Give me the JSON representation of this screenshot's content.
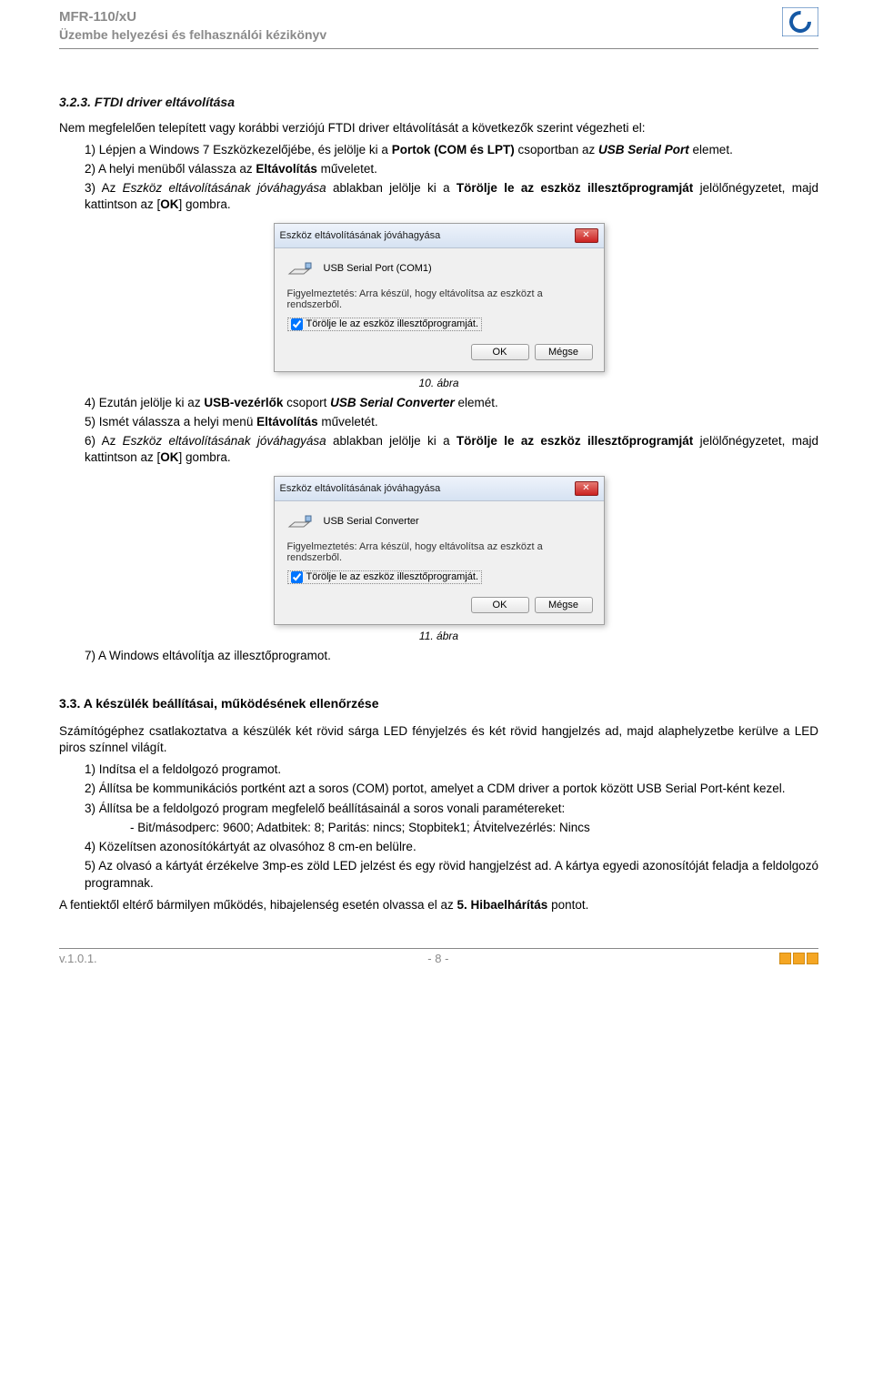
{
  "header": {
    "product": "MFR-110/xU",
    "subtitle": "Üzembe helyezési és felhasználói kézikönyv"
  },
  "s323": {
    "heading_num": "3.2.3.",
    "heading_text": "FTDI driver eltávolítása",
    "intro": "Nem megfelelően telepített vagy korábbi verziójú FTDI driver eltávolítását a következők szerint végezheti el:",
    "li1_a": "1) Lépjen a Windows 7 Eszközkezelőjébe, és jelölje ki a ",
    "li1_b": "Portok (COM és LPT)",
    "li1_c": " csoportban az ",
    "li1_d": "USB Serial Port",
    "li1_e": " elemet.",
    "li2_a": "2) A helyi menüből válassza az ",
    "li2_b": "Eltávolítás",
    "li2_c": " műveletet.",
    "li3_a": "3) Az ",
    "li3_b": "Eszköz eltávolításának jóváhagyása",
    "li3_c": " ablakban jelölje ki a ",
    "li3_d": "Törölje le az eszköz illesztőprogramját",
    "li3_e": " jelölőnégyzetet, majd kattintson az [",
    "li3_f": "OK",
    "li3_g": "] gombra.",
    "fig10": "10. ábra",
    "li4_a": "4) Ezután jelölje ki az ",
    "li4_b": "USB-vezérlők",
    "li4_c": " csoport ",
    "li4_d": "USB Serial Converter",
    "li4_e": " elemét.",
    "li5_a": "5) Ismét válassza a helyi menü ",
    "li5_b": "Eltávolítás",
    "li5_c": " műveletét.",
    "li6_a": "6) Az ",
    "li6_b": "Eszköz eltávolításának jóváhagyása",
    "li6_c": " ablakban jelölje ki a ",
    "li6_d": "Törölje le az eszköz illesztőprogramját",
    "li6_e": " jelölőnégyzetet, majd kattintson az [",
    "li6_f": "OK",
    "li6_g": "] gombra.",
    "fig11": "11. ábra",
    "li7": "7) A Windows eltávolítja az illesztőprogramot."
  },
  "dialog1": {
    "title": "Eszköz eltávolításának jóváhagyása",
    "device": "USB Serial Port (COM1)",
    "warn": "Figyelmeztetés: Arra készül, hogy eltávolítsa az eszközt a rendszerből.",
    "chk": "Törölje le az eszköz illesztőprogramját.",
    "ok": "OK",
    "cancel": "Mégse"
  },
  "dialog2": {
    "title": "Eszköz eltávolításának jóváhagyása",
    "device": "USB Serial Converter",
    "warn": "Figyelmeztetés: Arra készül, hogy eltávolítsa az eszközt a rendszerből.",
    "chk": "Törölje le az eszköz illesztőprogramját.",
    "ok": "OK",
    "cancel": "Mégse"
  },
  "s33": {
    "heading_num": "3.3.",
    "heading_text": "A készülék beállításai, működésének ellenőrzése",
    "intro": "Számítógéphez csatlakoztatva a készülék két rövid sárga LED fényjelzés és két rövid hangjelzés ad, majd alaphelyzetbe kerülve a LED piros színnel világít.",
    "li1": "1) Indítsa el a feldolgozó programot.",
    "li2": "2) Állítsa be kommunikációs portként azt a soros (COM) portot, amelyet a CDM driver a portok között USB Serial Port-ként kezel.",
    "li3": "3) Állítsa be a feldolgozó program megfelelő beállításainál a soros vonali paramétereket:",
    "li3_sub": "- Bit/másodperc: 9600; Adatbitek: 8; Paritás: nincs; Stopbitek1; Átvitelvezérlés: Nincs",
    "li4": "4) Közelítsen azonosítókártyát az olvasóhoz 8 cm-en belülre.",
    "li5": "5) Az olvasó a kártyát érzékelve 3mp-es zöld LED jelzést és egy rövid hangjelzést ad. A kártya egyedi azonosítóját feladja a feldolgozó programnak.",
    "outro_a": "A fentiektől eltérő bármilyen működés, hibajelenség esetén olvassa el az ",
    "outro_b": "5. Hibaelhárítás",
    "outro_c": " pontot."
  },
  "footer": {
    "version": "v.1.0.1.",
    "page": "- 8 -"
  }
}
